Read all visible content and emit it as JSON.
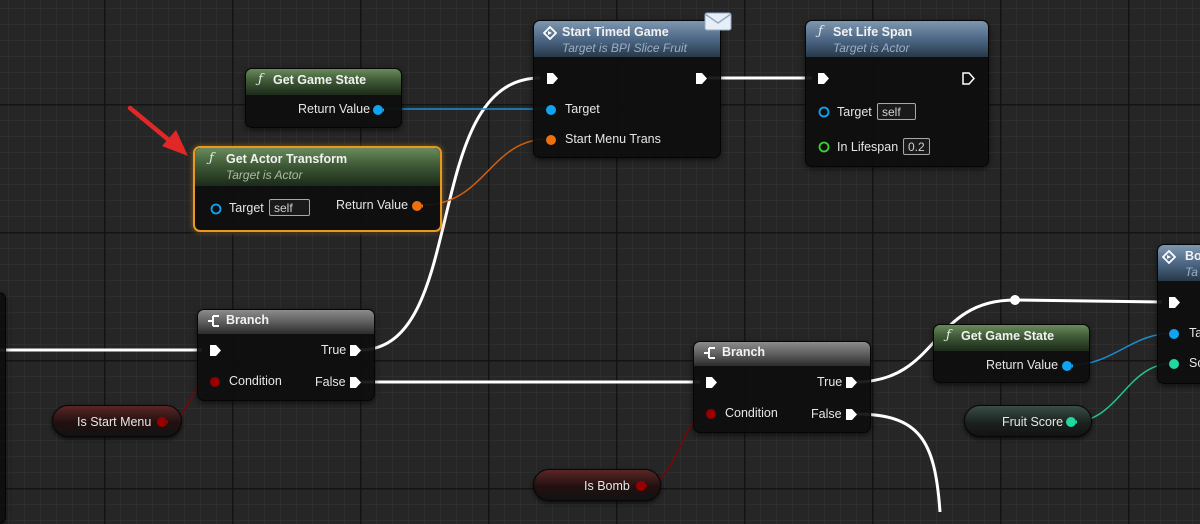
{
  "colors": {
    "exec_wire": "#ffffff",
    "object_pin": "#10a4f0",
    "struct_pin": "#f07010",
    "bool_pin": "#980000",
    "float_pin": "#3ad030",
    "score_pin": "#20d8a0",
    "selected_outline": "#e69a22",
    "arrow": "#e02828"
  },
  "nodes": {
    "get_game_state_1": {
      "title": "Get Game State",
      "return_label": "Return Value",
      "icon": "function-icon"
    },
    "get_actor_transform": {
      "title": "Get Actor Transform",
      "subtitle": "Target is Actor",
      "target_label": "Target",
      "target_value": "self",
      "return_label": "Return Value",
      "icon": "function-icon"
    },
    "start_timed_game": {
      "title": "Start Timed Game",
      "subtitle": "Target is BPI Slice Fruit",
      "target_label": "Target",
      "menu_trans_label": "Start Menu Trans",
      "icon": "interface-message-icon"
    },
    "set_life_span": {
      "title": "Set Life Span",
      "subtitle": "Target is Actor",
      "target_label": "Target",
      "target_value": "self",
      "lifespan_label": "In Lifespan",
      "lifespan_value": "0.2",
      "icon": "function-icon"
    },
    "branch_1": {
      "title": "Branch",
      "true_label": "True",
      "false_label": "False",
      "condition_label": "Condition",
      "icon": "branch-icon"
    },
    "branch_2": {
      "title": "Branch",
      "true_label": "True",
      "false_label": "False",
      "condition_label": "Condition",
      "icon": "branch-icon"
    },
    "get_game_state_2": {
      "title": "Get Game State",
      "return_label": "Return Value",
      "icon": "function-icon"
    },
    "partial_node": {
      "title": "Bo",
      "subtitle": "Ta",
      "pin1_label": "Ta",
      "pin2_label": "Sc"
    }
  },
  "variables": {
    "is_start_menu": "Is Start Menu",
    "is_bomb": "Is Bomb",
    "fruit_score": "Fruit Score"
  }
}
